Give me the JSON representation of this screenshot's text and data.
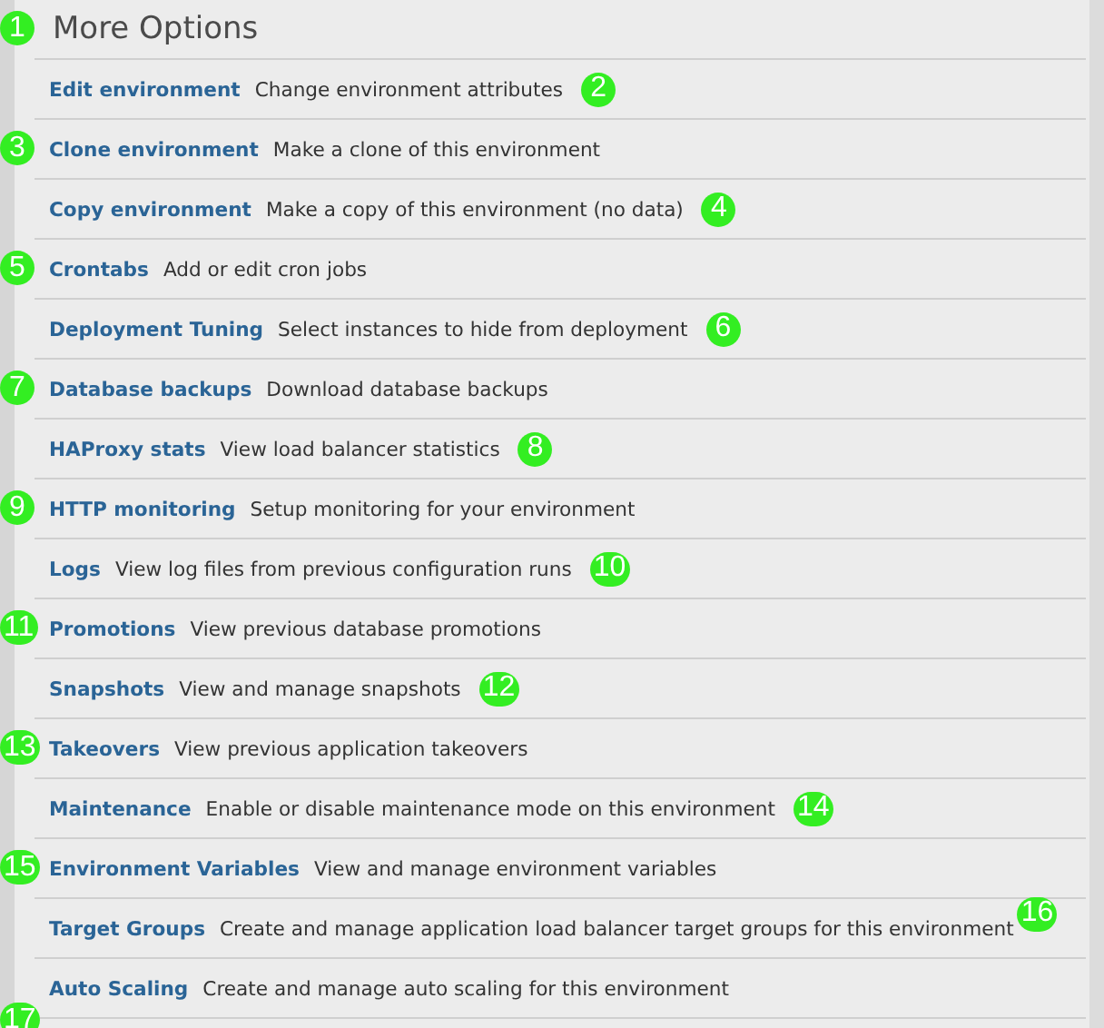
{
  "title": "More Options",
  "title_marker": "1",
  "options": [
    {
      "link": "Edit environment",
      "description": "Change environment attributes",
      "marker": "2",
      "kind": "end"
    },
    {
      "link": "Clone environment",
      "description": "Make a clone of this environment",
      "marker": "3",
      "kind": "left"
    },
    {
      "link": "Copy environment",
      "description": "Make a copy of this environment (no data)",
      "marker": "4",
      "kind": "end"
    },
    {
      "link": "Crontabs",
      "description": "Add or edit cron jobs",
      "marker": "5",
      "kind": "left"
    },
    {
      "link": "Deployment Tuning",
      "description": "Select instances to hide from deployment",
      "marker": "6",
      "kind": "end"
    },
    {
      "link": "Database backups",
      "description": "Download database backups",
      "marker": "7",
      "kind": "left"
    },
    {
      "link": "HAProxy stats",
      "description": "View load balancer statistics",
      "marker": "8",
      "kind": "end"
    },
    {
      "link": "HTTP monitoring",
      "description": "Setup monitoring for your environment",
      "marker": "9",
      "kind": "left"
    },
    {
      "link": "Logs",
      "description": "View log files from previous configuration runs",
      "marker": "10",
      "kind": "end"
    },
    {
      "link": "Promotions",
      "description": "View previous database promotions",
      "marker": "11",
      "kind": "left"
    },
    {
      "link": "Snapshots",
      "description": "View and manage snapshots",
      "marker": "12",
      "kind": "end"
    },
    {
      "link": "Takeovers",
      "description": "View previous application takeovers",
      "marker": "13",
      "kind": "left"
    },
    {
      "link": "Maintenance",
      "description": "Enable or disable maintenance mode on this environment",
      "marker": "14",
      "kind": "end"
    },
    {
      "link": "Environment Variables",
      "description": "View and manage environment variables",
      "marker": "15",
      "kind": "left"
    },
    {
      "link": "Target Groups",
      "description": "Create and manage application load balancer target groups for this environment",
      "marker": "16",
      "kind": "end"
    },
    {
      "link": "Auto Scaling",
      "description": "Create and manage auto scaling for this environment",
      "marker": "17",
      "kind": "below"
    }
  ]
}
